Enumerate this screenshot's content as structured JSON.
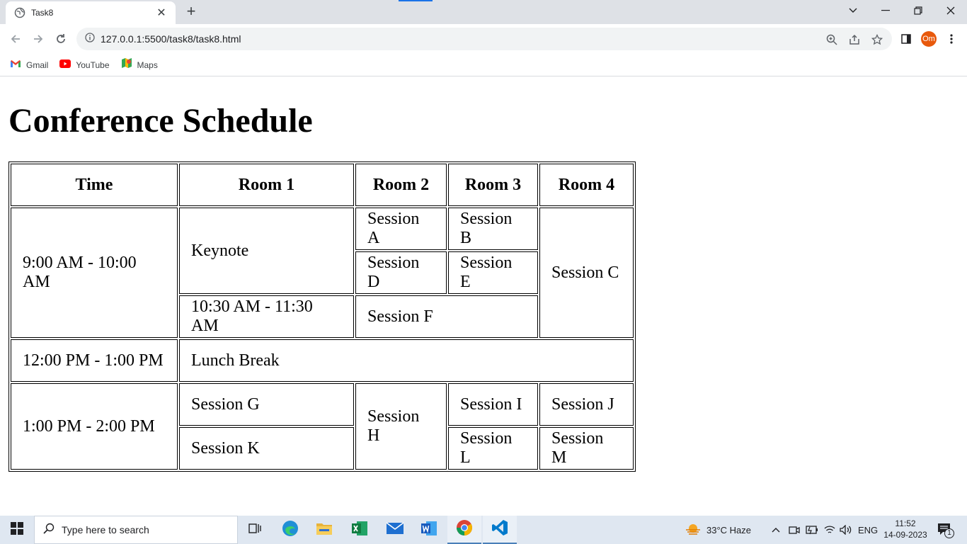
{
  "browser": {
    "tab_title": "Task8",
    "url": "127.0.0.1:5500/task8/task8.html",
    "avatar_initials": "Om",
    "bookmarks": [
      {
        "label": "Gmail",
        "icon": "gmail-icon"
      },
      {
        "label": "YouTube",
        "icon": "youtube-icon"
      },
      {
        "label": "Maps",
        "icon": "maps-icon"
      }
    ]
  },
  "page": {
    "title": "Conference Schedule",
    "table": {
      "headers": [
        "Time",
        "Room 1",
        "Room 2",
        "Room 3",
        "Room 4"
      ],
      "cells": {
        "time_1": "9:00 AM - 10:00 AM",
        "keynote": "Keynote",
        "session_a": "Session A",
        "session_b": "Session B",
        "session_c": "Session C",
        "session_d": "Session D",
        "session_e": "Session E",
        "time_1030": "10:30 AM - 11:30 AM",
        "session_f": "Session F",
        "time_12": "12:00 PM - 1:00 PM",
        "lunch": "Lunch Break",
        "time_1pm": "1:00 PM - 2:00 PM",
        "session_g": "Session G",
        "session_h": "Session H",
        "session_i": "Session I",
        "session_j": "Session J",
        "session_k": "Session K",
        "session_l": "Session L",
        "session_m": "Session M"
      }
    }
  },
  "taskbar": {
    "search_placeholder": "Type here to search",
    "weather": "33°C  Haze",
    "language": "ENG",
    "time": "11:52",
    "date": "14-09-2023",
    "notification_count": "1"
  },
  "colors": {
    "accent": "#1a73e8",
    "avatar": "#e8590c"
  }
}
